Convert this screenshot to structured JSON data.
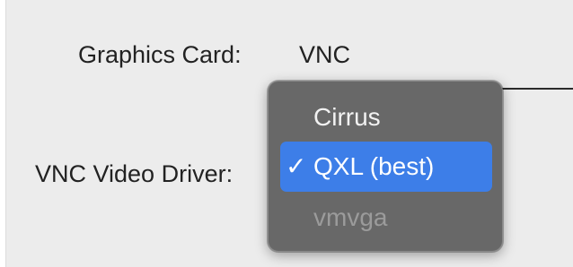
{
  "form": {
    "graphics_card_label": "Graphics Card:",
    "graphics_card_value": "VNC",
    "vnc_video_driver_label": "VNC Video Driver:"
  },
  "dropdown": {
    "check_glyph": "✓",
    "options": [
      {
        "label": "Cirrus",
        "state": "enabled"
      },
      {
        "label": "QXL (best)",
        "state": "selected"
      },
      {
        "label": "vmvga",
        "state": "disabled"
      }
    ]
  },
  "colors": {
    "panel_bg": "#ececec",
    "menu_bg": "#686868",
    "highlight": "#3d7ee8",
    "disabled_text": "#9b9b9b"
  }
}
